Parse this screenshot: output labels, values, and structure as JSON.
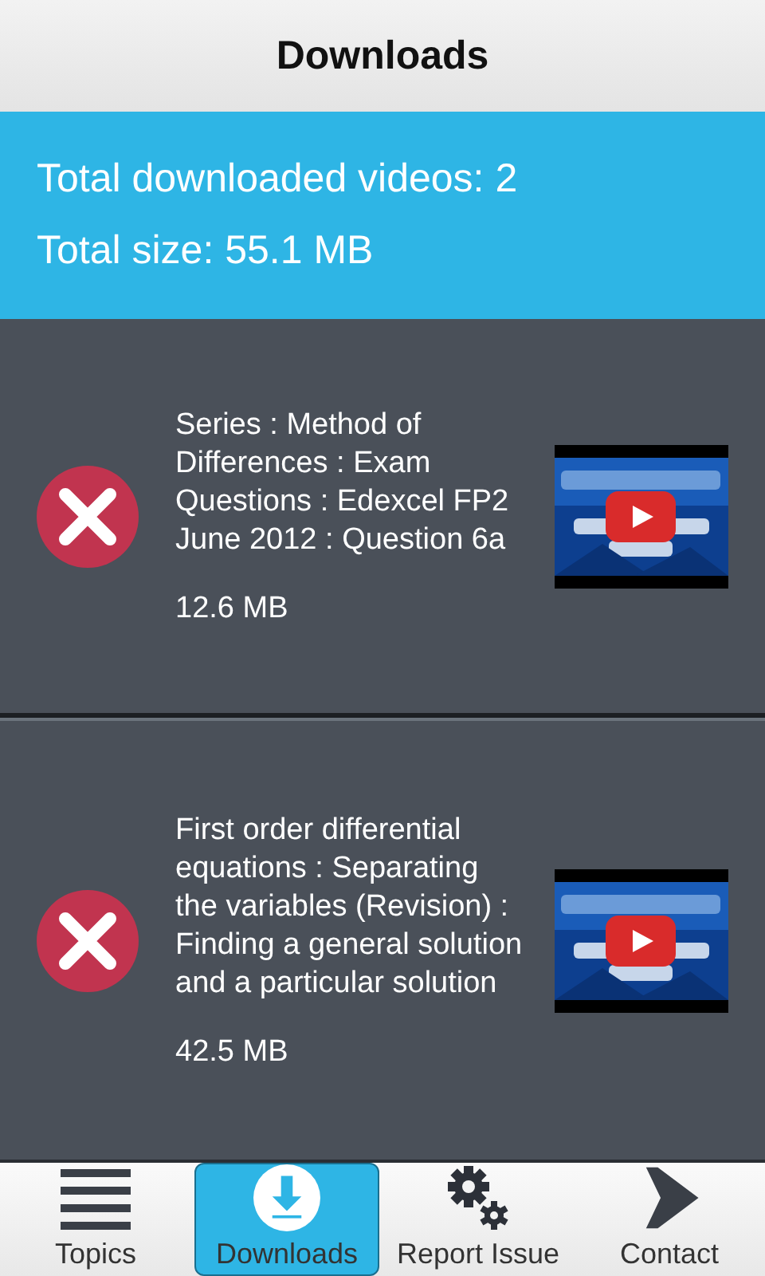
{
  "header": {
    "title": "Downloads"
  },
  "summary": {
    "total_videos": "Total downloaded videos: 2",
    "total_size": "Total size: 55.1 MB"
  },
  "downloads": [
    {
      "title": "Series : Method of Differences : Exam Questions : Edexcel FP2 June 2012 : Question 6a",
      "size": "12.6 MB"
    },
    {
      "title": "First order differential equations : Separating the variables (Revision) : Finding a general solution and a particular solution",
      "size": "42.5 MB"
    }
  ],
  "nav": [
    {
      "kind": "topics",
      "label": "Topics",
      "selected": false
    },
    {
      "kind": "downloads",
      "label": "Downloads",
      "selected": true
    },
    {
      "kind": "report",
      "label": "Report Issue",
      "selected": false
    },
    {
      "kind": "contact",
      "label": "Contact",
      "selected": false
    }
  ]
}
